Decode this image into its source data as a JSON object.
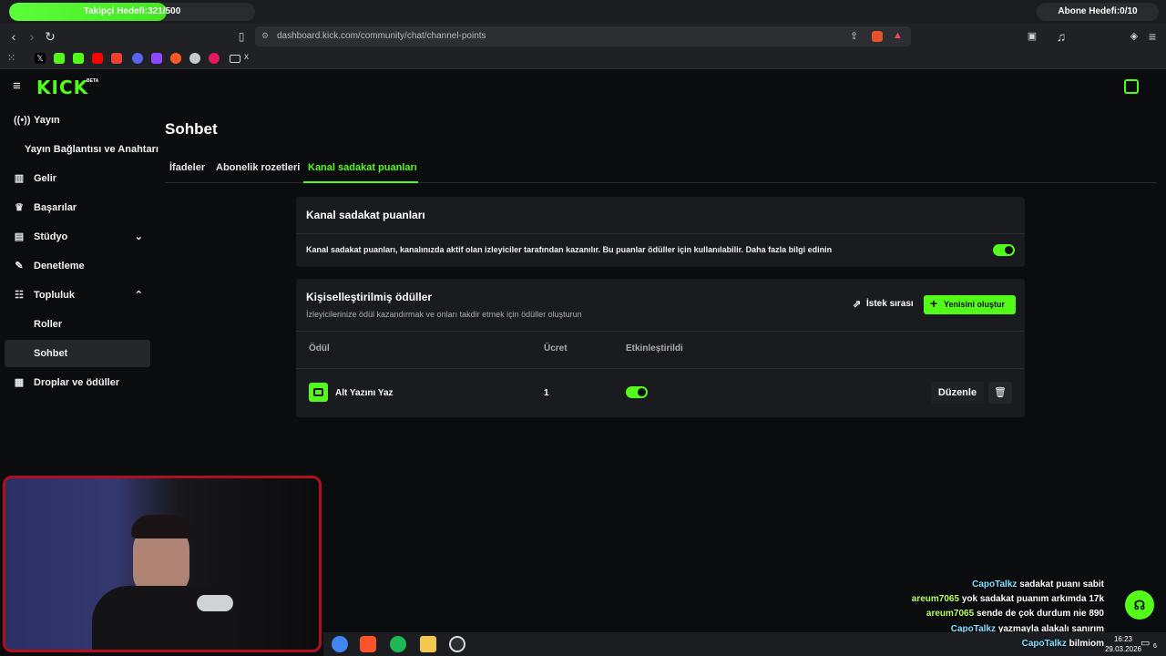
{
  "overlay": {
    "follow_goal_text": "Takipçi Hedefi:321/500",
    "follow_goal_progress": 0.642,
    "sub_goal_text": "Abone Hedefi:0/10"
  },
  "browser": {
    "url": "dashboard.kick.com/community/chat/channel-points",
    "bookmark_folder_label": "x"
  },
  "app": {
    "logo_text": "KICK",
    "logo_badge": "BETA",
    "brand_color": "#53fc18"
  },
  "sidebar": {
    "items": [
      {
        "label": "Yayın",
        "icon": "broadcast-icon"
      },
      {
        "label": "Yayın Bağlantısı ve Anahtarı",
        "icon": ""
      },
      {
        "label": "Gelir",
        "icon": "revenue-icon"
      },
      {
        "label": "Başarılar",
        "icon": "trophy-icon"
      },
      {
        "label": "Stüdyo",
        "icon": "studio-icon"
      },
      {
        "label": "Denetleme",
        "icon": "wrench-icon"
      },
      {
        "label": "Topluluk",
        "icon": "community-icon"
      },
      {
        "label": "Roller",
        "icon": ""
      },
      {
        "label": "Sohbet",
        "icon": ""
      },
      {
        "label": "Droplar ve ödüller",
        "icon": "drops-icon"
      }
    ]
  },
  "main": {
    "title": "Sohbet",
    "tabs": [
      {
        "label": "İfadeler"
      },
      {
        "label": "Abonelik rozetleri"
      },
      {
        "label": "Kanal sadakat puanları"
      }
    ],
    "active_tab": "Kanal sadakat puanları",
    "loyalty_card": {
      "title": "Kanal sadakat puanları",
      "description": "Kanal sadakat puanları, kanalınızda aktif olan izleyiciler tarafından kazanılır. Bu puanlar ödüller için kullanılabilir. Daha fazla bilgi edinin",
      "enabled": true
    },
    "rewards_card": {
      "title": "Kişiselleştirilmiş ödüller",
      "subtitle": "İzleyicilerinize ödül kazandırmak ve onları takdir etmek için ödüller oluşturun",
      "queue_label": "İstek sırası",
      "create_label": "Yenisini oluştur",
      "columns": [
        "Ödül",
        "Ücret",
        "Etkinleştirildi"
      ],
      "rows": [
        {
          "name": "Alt Yazını Yaz",
          "cost": "1",
          "enabled": true,
          "edit_label": "Düzenle"
        }
      ]
    }
  },
  "chat": [
    {
      "user": "CapoTalkz",
      "message": "sadakat puanı sabit"
    },
    {
      "user": "areum7065",
      "message": "yok sadakat puanım arkımda 17k"
    },
    {
      "user": "areum7065",
      "message": "sende de çok durdum nie 890"
    },
    {
      "user": "CapoTalkz",
      "message": "yazmayla alakalı sanırım"
    },
    {
      "user": "CapoTalkz",
      "message": "bilmiom"
    }
  ],
  "taskbar": {
    "time": "16:23",
    "date": "29.03.2026",
    "notification_count": "6"
  }
}
